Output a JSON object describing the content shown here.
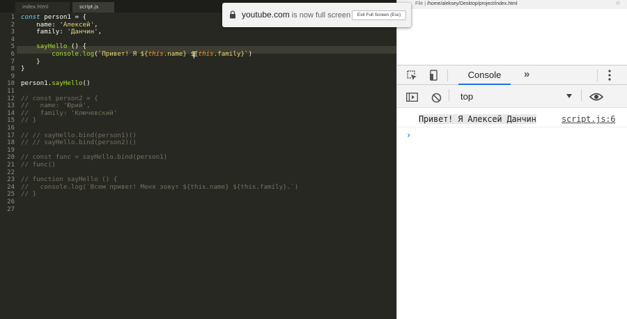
{
  "editor": {
    "tabs": [
      "index.html",
      "script.js"
    ],
    "line_numbers": [
      "1",
      "2",
      "3",
      "4",
      "5",
      "6",
      "7",
      "8",
      "9",
      "10",
      "11",
      "12",
      "13",
      "14",
      "15",
      "16",
      "17",
      "18",
      "19",
      "20",
      "21",
      "22",
      "23",
      "24",
      "25",
      "26",
      "27"
    ],
    "lines": [
      [
        [
          "kw",
          "const "
        ],
        [
          "",
          "person1 = {"
        ]
      ],
      [
        [
          "",
          "    name: "
        ],
        [
          "str",
          "'Алексей'"
        ],
        [
          "",
          ","
        ]
      ],
      [
        [
          "",
          "    family: "
        ],
        [
          "str",
          "'Данчин'"
        ],
        [
          "",
          ","
        ]
      ],
      [],
      [
        [
          "fn",
          "    sayHello"
        ],
        [
          "",
          " () {"
        ]
      ],
      [
        [
          "",
          "        "
        ],
        [
          "fn",
          "console.log"
        ],
        [
          "",
          "("
        ],
        [
          "str",
          "`Привет! Я ${"
        ],
        [
          "kwthis",
          "this"
        ],
        [
          "str",
          ".name} ${"
        ],
        [
          "kwthis",
          "this"
        ],
        [
          "str",
          ".family}`"
        ],
        [
          "",
          ")"
        ]
      ],
      [
        [
          "",
          "    }"
        ]
      ],
      [
        [
          "",
          "}"
        ]
      ],
      [],
      [
        [
          "",
          "person1."
        ],
        [
          "fn",
          "sayHello"
        ],
        [
          "",
          "()"
        ]
      ],
      [],
      [
        [
          "cmt",
          "// const person2 = {"
        ]
      ],
      [
        [
          "cmt",
          "//   name: 'Юрий',"
        ]
      ],
      [
        [
          "cmt",
          "//   family: 'Ключевский'"
        ]
      ],
      [
        [
          "cmt",
          "// }"
        ]
      ],
      [],
      [
        [
          "cmt",
          "// // sayHello.bind(person1)()"
        ]
      ],
      [
        [
          "cmt",
          "// // sayHello.bind(person2)()"
        ]
      ],
      [],
      [
        [
          "cmt",
          "// const func = sayHello.bind(person1)"
        ]
      ],
      [
        [
          "cmt",
          "// func()"
        ]
      ],
      [],
      [
        [
          "cmt",
          "// function sayHello () {"
        ]
      ],
      [
        [
          "cmt",
          "//   console.log(`Всем привет! Меня зовут ${this.name} ${this.family}.`)"
        ]
      ],
      [
        [
          "cmt",
          "// }"
        ]
      ],
      [],
      []
    ]
  },
  "toast": {
    "host": "youtube.com",
    "message": " is now full screen",
    "exit_label": "Exit Full Screen (Esc)"
  },
  "browser": {
    "file_label": "File",
    "url": "/home/aleksey/Desktop/project/index.html"
  },
  "devtools": {
    "console_tab": "Console",
    "more_tabs": "»",
    "context": "top",
    "log_message": "Привет! Я Алексей Данчин",
    "log_source": "script.js:6",
    "prompt": "›"
  },
  "colors": {
    "editor_bg": "#272822",
    "keyword": "#66d9ef",
    "string": "#e6db74",
    "function": "#a6e22e",
    "this": "#fd971f",
    "comment": "#75715e",
    "devtools_accent": "#1a73e8"
  },
  "icons": {
    "lock": "lock-icon",
    "inspect": "inspect-element-icon",
    "device": "device-toolbar-icon",
    "sidebar": "console-sidebar-icon",
    "clear": "clear-console-icon",
    "eye": "live-expression-eye-icon",
    "kebab": "more-options-icon"
  }
}
